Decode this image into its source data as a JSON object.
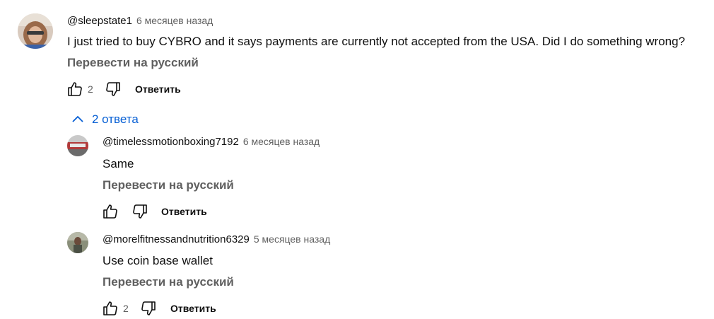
{
  "top_comment": {
    "author": "@sleepstate1",
    "time": "6 месяцев назад",
    "text": "I just tried to buy CYBRO and it says payments are currently not accepted from the USA. Did I do something wrong?",
    "translate_label": "Перевести на русский",
    "like_count": "2",
    "reply_label": "Ответить"
  },
  "replies_toggle": {
    "label": "2 ответа",
    "icon": "chevron-up-icon"
  },
  "replies": [
    {
      "author": "@timelessmotionboxing7192",
      "time": "6 месяцев назад",
      "text": "Same",
      "translate_label": "Перевести на русский",
      "like_count": "",
      "reply_label": "Ответить"
    },
    {
      "author": "@morelfitnessandnutrition6329",
      "time": "5 месяцев назад",
      "text": "Use coin base wallet",
      "translate_label": "Перевести на русский",
      "like_count": "2",
      "reply_label": "Ответить"
    }
  ],
  "colors": {
    "link": "#065fd4",
    "secondary": "#606060",
    "primary": "#0f0f0f"
  }
}
